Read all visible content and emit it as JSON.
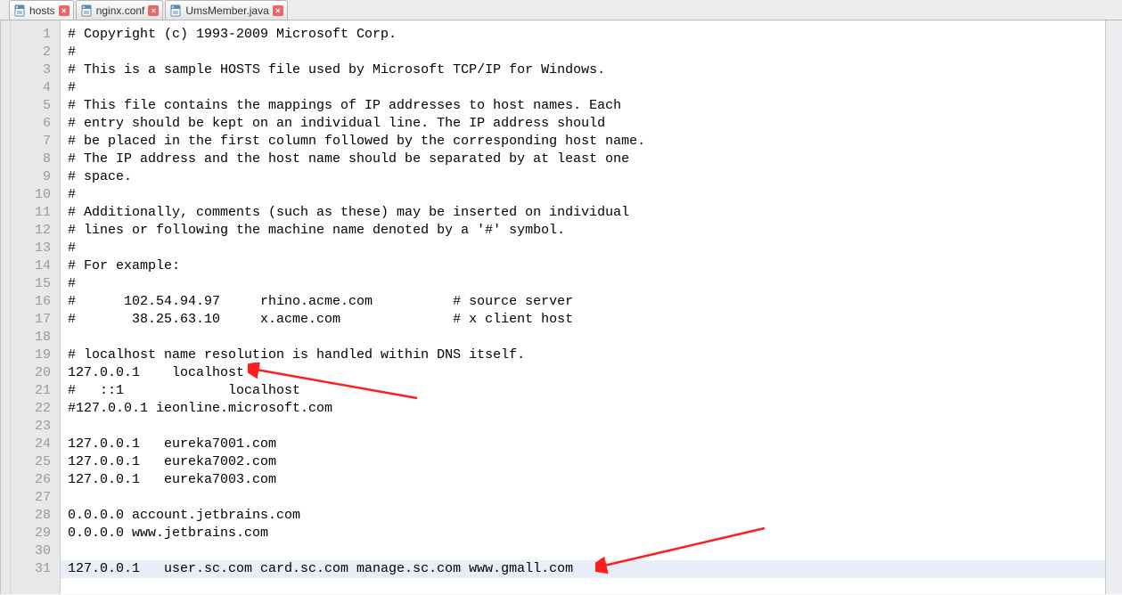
{
  "tabs": [
    {
      "label": "hosts",
      "active": true,
      "modified": true
    },
    {
      "label": "nginx.conf",
      "active": false,
      "modified": false
    },
    {
      "label": "UmsMember.java",
      "active": false,
      "modified": false
    }
  ],
  "lines": [
    {
      "n": 1,
      "t": "# Copyright (c) 1993-2009 Microsoft Corp."
    },
    {
      "n": 2,
      "t": "#"
    },
    {
      "n": 3,
      "t": "# This is a sample HOSTS file used by Microsoft TCP/IP for Windows."
    },
    {
      "n": 4,
      "t": "#"
    },
    {
      "n": 5,
      "t": "# This file contains the mappings of IP addresses to host names. Each"
    },
    {
      "n": 6,
      "t": "# entry should be kept on an individual line. The IP address should"
    },
    {
      "n": 7,
      "t": "# be placed in the first column followed by the corresponding host name."
    },
    {
      "n": 8,
      "t": "# The IP address and the host name should be separated by at least one"
    },
    {
      "n": 9,
      "t": "# space."
    },
    {
      "n": 10,
      "t": "#"
    },
    {
      "n": 11,
      "t": "# Additionally, comments (such as these) may be inserted on individual"
    },
    {
      "n": 12,
      "t": "# lines or following the machine name denoted by a '#' symbol."
    },
    {
      "n": 13,
      "t": "#"
    },
    {
      "n": 14,
      "t": "# For example:"
    },
    {
      "n": 15,
      "t": "#"
    },
    {
      "n": 16,
      "t": "#      102.54.94.97     rhino.acme.com          # source server"
    },
    {
      "n": 17,
      "t": "#       38.25.63.10     x.acme.com              # x client host"
    },
    {
      "n": 18,
      "t": ""
    },
    {
      "n": 19,
      "t": "# localhost name resolution is handled within DNS itself."
    },
    {
      "n": 20,
      "t": "127.0.0.1    localhost"
    },
    {
      "n": 21,
      "t": "#   ::1             localhost"
    },
    {
      "n": 22,
      "t": "#127.0.0.1 ieonline.microsoft.com"
    },
    {
      "n": 23,
      "t": ""
    },
    {
      "n": 24,
      "t": "127.0.0.1   eureka7001.com"
    },
    {
      "n": 25,
      "t": "127.0.0.1   eureka7002.com"
    },
    {
      "n": 26,
      "t": "127.0.0.1   eureka7003.com"
    },
    {
      "n": 27,
      "t": ""
    },
    {
      "n": 28,
      "t": "0.0.0.0 account.jetbrains.com"
    },
    {
      "n": 29,
      "t": "0.0.0.0 www.jetbrains.com"
    },
    {
      "n": 30,
      "t": ""
    },
    {
      "n": 31,
      "t": "127.0.0.1   user.sc.com card.sc.com manage.sc.com www.gmall.com",
      "hl": true
    }
  ],
  "icons": {
    "file": "file-icon",
    "close": "×"
  },
  "annotations": {
    "arrow1": {
      "target_line": 20
    },
    "arrow2": {
      "target_line": 31
    }
  }
}
